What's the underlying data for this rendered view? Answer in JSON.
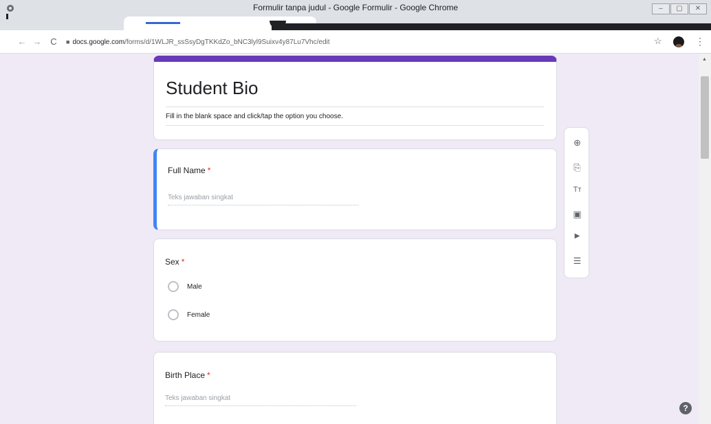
{
  "window": {
    "title": "Formulir tanpa judul - Google Formulir - Google Chrome",
    "controls": {
      "minimize": "–",
      "maximize": "▢",
      "close": "✕"
    }
  },
  "browser": {
    "url_host": "docs.google.com",
    "url_path": "/forms/d/1WLJR_ssSsyDgTKKdZo_bNC3lyl9Suixv4y87Lu7Vhc/edit",
    "icons": {
      "back": "←",
      "forward": "→",
      "reload": "C",
      "lock": "■",
      "star": "☆",
      "menu": "⋮"
    }
  },
  "form": {
    "title": "Student Bio",
    "description": "Fill in the blank space and click/tap the option you choose.",
    "questions": [
      {
        "title": "Full Name",
        "required_mark": "*",
        "placeholder": "Teks jawaban singkat"
      },
      {
        "title": "Sex",
        "required_mark": "*",
        "options": [
          "Male",
          "Female"
        ]
      },
      {
        "title": "Birth Place",
        "required_mark": "*",
        "placeholder": "Teks jawaban singkat"
      }
    ]
  },
  "side_toolbar": {
    "icons": [
      "add-question-icon",
      "import-questions-icon",
      "add-title-icon",
      "add-image-icon",
      "add-video-icon",
      "add-section-icon"
    ],
    "glyphs": [
      "⊕",
      "⎘",
      "Tт",
      "▣",
      "▶",
      "☰"
    ]
  },
  "help": {
    "glyph": "?"
  },
  "scrollbar": {
    "up": "▲"
  },
  "colors": {
    "theme_purple": "#673ab7",
    "active_blue": "#4285f4",
    "background": "#efeaf6"
  }
}
